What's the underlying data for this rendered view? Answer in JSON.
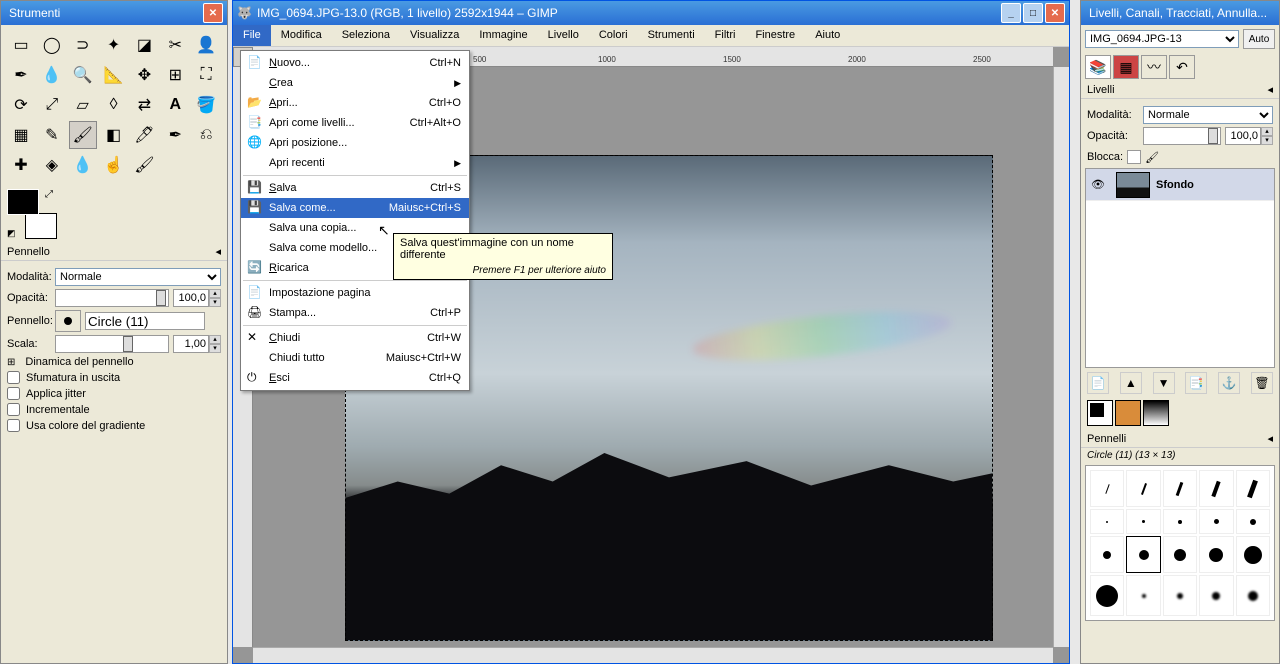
{
  "toolbox": {
    "title": "Strumenti",
    "panelTitle": "Pennello",
    "mode_label": "Modalità:",
    "mode_value": "Normale",
    "opacity_label": "Opacità:",
    "opacity_value": "100,0",
    "brush_label": "Pennello:",
    "brush_value": "Circle (11)",
    "scale_label": "Scala:",
    "scale_value": "1,00",
    "dynamic": "Dinamica del pennello",
    "fade": "Sfumatura in uscita",
    "jitter": "Applica jitter",
    "incremental": "Incrementale",
    "gradient": "Usa colore del gradiente"
  },
  "imgwin": {
    "title": "IMG_0694.JPG-13.0 (RGB, 1 livello) 2592x1944 – GIMP",
    "menus": [
      "File",
      "Modifica",
      "Seleziona",
      "Visualizza",
      "Immagine",
      "Livello",
      "Colori",
      "Strumenti",
      "Filtri",
      "Finestre",
      "Aiuto"
    ],
    "ruler_ticks": [
      "500",
      "1000",
      "1500",
      "2000",
      "2500"
    ]
  },
  "filemenu": [
    {
      "type": "item",
      "label": "Nuovo...",
      "u": "N",
      "sc": "Ctrl+N",
      "ico": "📄"
    },
    {
      "type": "sub",
      "label": "Crea",
      "u": "C"
    },
    {
      "type": "item",
      "label": "Apri...",
      "u": "A",
      "sc": "Ctrl+O",
      "ico": "📂"
    },
    {
      "type": "item",
      "label": "Apri come livelli...",
      "u": "",
      "sc": "Ctrl+Alt+O",
      "ico": "📑"
    },
    {
      "type": "item",
      "label": "Apri posizione...",
      "u": "",
      "ico": "🌐"
    },
    {
      "type": "sub",
      "label": "Apri recenti",
      "u": ""
    },
    {
      "type": "sep"
    },
    {
      "type": "item",
      "label": "Salva",
      "u": "S",
      "sc": "Ctrl+S",
      "ico": "💾"
    },
    {
      "type": "item",
      "label": "Salva come...",
      "u": "",
      "sc": "Maiusc+Ctrl+S",
      "hl": true,
      "ico": "💾"
    },
    {
      "type": "item",
      "label": "Salva una copia...",
      "u": ""
    },
    {
      "type": "item",
      "label": "Salva come modello..."
    },
    {
      "type": "item",
      "label": "Ricarica",
      "u": "R",
      "ico": "🔄"
    },
    {
      "type": "sep"
    },
    {
      "type": "item",
      "label": "Impostazione pagina",
      "ico": "📄"
    },
    {
      "type": "item",
      "label": "Stampa...",
      "u": "",
      "sc": "Ctrl+P",
      "ico": "🖨"
    },
    {
      "type": "sep"
    },
    {
      "type": "item",
      "label": "Chiudi",
      "u": "C",
      "sc": "Ctrl+W",
      "ico": "✕"
    },
    {
      "type": "item",
      "label": "Chiudi tutto",
      "u": "",
      "sc": "Maiusc+Ctrl+W"
    },
    {
      "type": "item",
      "label": "Esci",
      "u": "E",
      "sc": "Ctrl+Q",
      "ico": "⏻"
    }
  ],
  "tooltip": {
    "main": "Salva quest'immagine con un nome differente",
    "sub": "Premere F1 per ulteriore aiuto"
  },
  "rightpanel": {
    "title": "Livelli, Canali, Tracciati, Annulla...",
    "image_selector": "IMG_0694.JPG-13",
    "auto": "Auto",
    "layers_label": "Livelli",
    "mode_label": "Modalità:",
    "mode_value": "Normale",
    "opacity_label": "Opacità:",
    "opacity_value": "100,0",
    "lock_label": "Blocca:",
    "layer_name": "Sfondo",
    "brushes_label": "Pennelli",
    "brush_info": "Circle (11) (13 × 13)"
  }
}
